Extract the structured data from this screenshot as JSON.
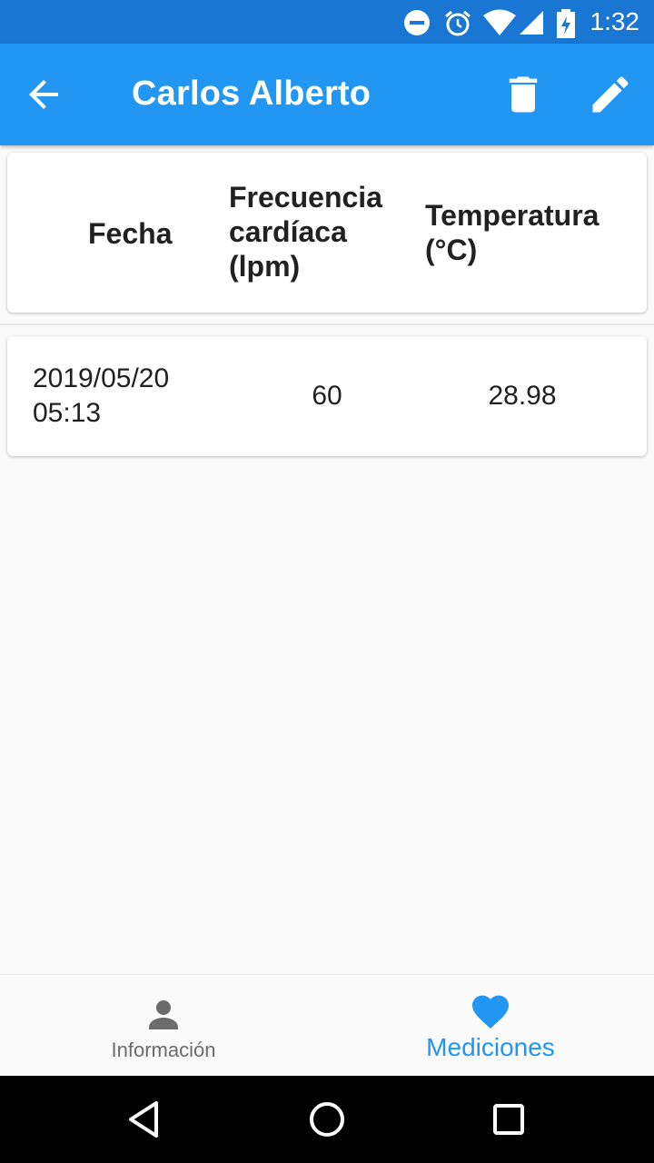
{
  "status_bar": {
    "time": "1:32",
    "icons": [
      "do-not-disturb-icon",
      "alarm-icon",
      "wifi-icon",
      "signal-icon",
      "battery-charging-icon"
    ]
  },
  "app_bar": {
    "title": "Carlos Alberto",
    "back_icon": "arrow-back-icon",
    "actions": [
      "delete-icon",
      "edit-icon"
    ]
  },
  "table": {
    "headers": {
      "fecha": "Fecha",
      "frecuencia": "Frecuencia cardíaca (lpm)",
      "temperatura": "Temperatura (°C)"
    },
    "rows": [
      {
        "fecha": "2019/05/20 05:13",
        "frecuencia": "60",
        "temperatura": "28.98"
      }
    ]
  },
  "bottom_nav": {
    "items": [
      {
        "label": "Información",
        "icon": "person-icon",
        "active": false
      },
      {
        "label": "Mediciones",
        "icon": "heart-icon",
        "active": true
      }
    ]
  },
  "colors": {
    "status_bar": "#1976d2",
    "app_bar": "#2196f3",
    "accent": "#2196f3",
    "inactive": "#6b6b6b"
  },
  "system_nav": [
    "back-triangle-icon",
    "home-circle-icon",
    "recents-square-icon"
  ]
}
